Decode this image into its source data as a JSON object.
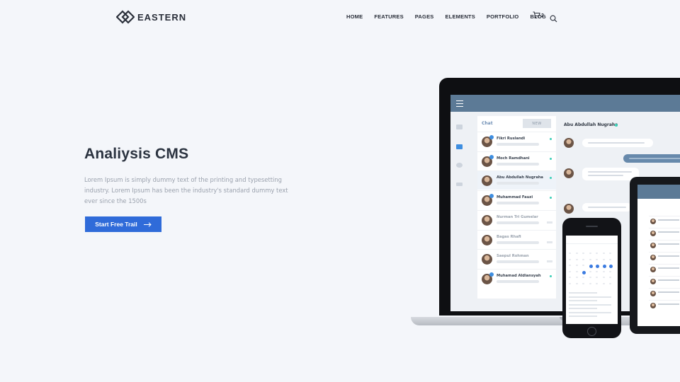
{
  "brand": {
    "name": "EASTERN"
  },
  "nav": {
    "items": [
      "HOME",
      "FEATURES",
      "PAGES",
      "ELEMENTS",
      "PORTFOLIO",
      "BLOG"
    ],
    "cart_count": "2",
    "icons": {
      "cart": "cart-icon",
      "search": "search-icon"
    }
  },
  "hero": {
    "title": "Analiysis CMS",
    "description": "Lorem Ipsum is simply dummy text of the printing and typesetting industry. Lorem Ipsum has been the industry's standard dummy text ever since the 1500s",
    "cta_label": "Start Free Trail",
    "cta_icon": "arrow-right-icon"
  },
  "colors": {
    "accent": "#2f6bd9",
    "app_header": "#5c7a96",
    "online": "#3ccfb7",
    "page_bg": "#f4f6fa"
  },
  "device_app": {
    "chat_label": "Chat",
    "new_label": "NEW",
    "active_conversation": "Abu Abdullah Nugraha",
    "contacts": [
      {
        "name": "Fikri Ruslandi",
        "badge": true,
        "online": true,
        "dim": false
      },
      {
        "name": "Moch Ramdhani",
        "badge": true,
        "online": true,
        "dim": false
      },
      {
        "name": "Abu Abdullah Nugraha",
        "badge": false,
        "online": true,
        "dim": false,
        "active": true
      },
      {
        "name": "Muhammad Fauzi",
        "badge": true,
        "online": true,
        "dim": false
      },
      {
        "name": "Nurman Tri Gumelar",
        "badge": false,
        "online": false,
        "dim": true
      },
      {
        "name": "Bagas Rhafi",
        "badge": false,
        "online": false,
        "dim": true
      },
      {
        "name": "Saepul Rohman",
        "badge": false,
        "online": false,
        "dim": true
      },
      {
        "name": "Muhamad Aldiansyah",
        "badge": true,
        "online": true,
        "dim": false
      }
    ]
  }
}
